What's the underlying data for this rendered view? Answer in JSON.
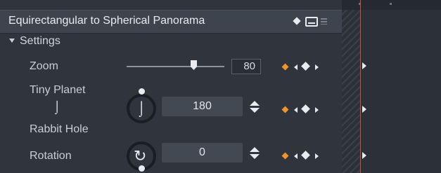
{
  "header": {
    "title": "Equirectangular to Spherical Panorama",
    "icons": [
      "keyframe-diamond-icon",
      "monitor-icon",
      "menu-icon"
    ]
  },
  "settings": {
    "section_label": "Settings",
    "zoom": {
      "label": "Zoom",
      "value": "80",
      "slider_fraction": 0.8
    },
    "tiny_planet": {
      "label": "Tiny Planet",
      "value": "180"
    },
    "rabbit_hole": {
      "label": "Rabbit Hole"
    },
    "rotation": {
      "label": "Rotation",
      "value": "0"
    }
  },
  "colors": {
    "accent_keyframe": "#f0952a",
    "playhead": "#d14b3b",
    "panel_bg": "#30353d",
    "header_bg": "#3e444d"
  }
}
